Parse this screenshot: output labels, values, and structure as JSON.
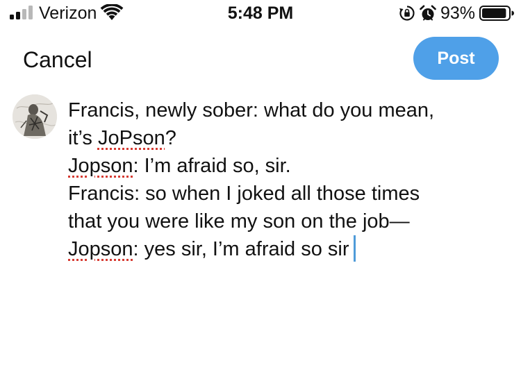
{
  "status_bar": {
    "carrier": "Verizon",
    "time": "5:48 PM",
    "battery_percent": "93%",
    "battery_level": 0.93,
    "signal_bars_active": 2,
    "signal_bars_total": 4,
    "icons": [
      "signal-icon",
      "wifi-icon",
      "rotation-lock-icon",
      "alarm-icon",
      "battery-icon"
    ]
  },
  "nav": {
    "cancel_label": "Cancel",
    "post_label": "Post"
  },
  "colors": {
    "post_button": "#4fa0e8",
    "spellcheck_underline": "#d63a32",
    "caret": "#4f9bd9"
  },
  "compose": {
    "avatar_icon": "avatar-icon",
    "lines": [
      {
        "before": "Francis, newly sober: what do you mean,",
        "misspelled": "",
        "after": ""
      },
      {
        "before": "it’s ",
        "misspelled": "JoPson",
        "after": "?"
      },
      {
        "before": "",
        "misspelled": "Jopson",
        "after": ": I’m afraid so, sir."
      },
      {
        "before": "Francis: so when I joked all those times",
        "misspelled": "",
        "after": ""
      },
      {
        "before": "that you were like my son on the job—",
        "misspelled": "",
        "after": ""
      },
      {
        "before": "",
        "misspelled": "Jopson",
        "after": ": yes sir, I’m afraid so sir"
      }
    ]
  }
}
